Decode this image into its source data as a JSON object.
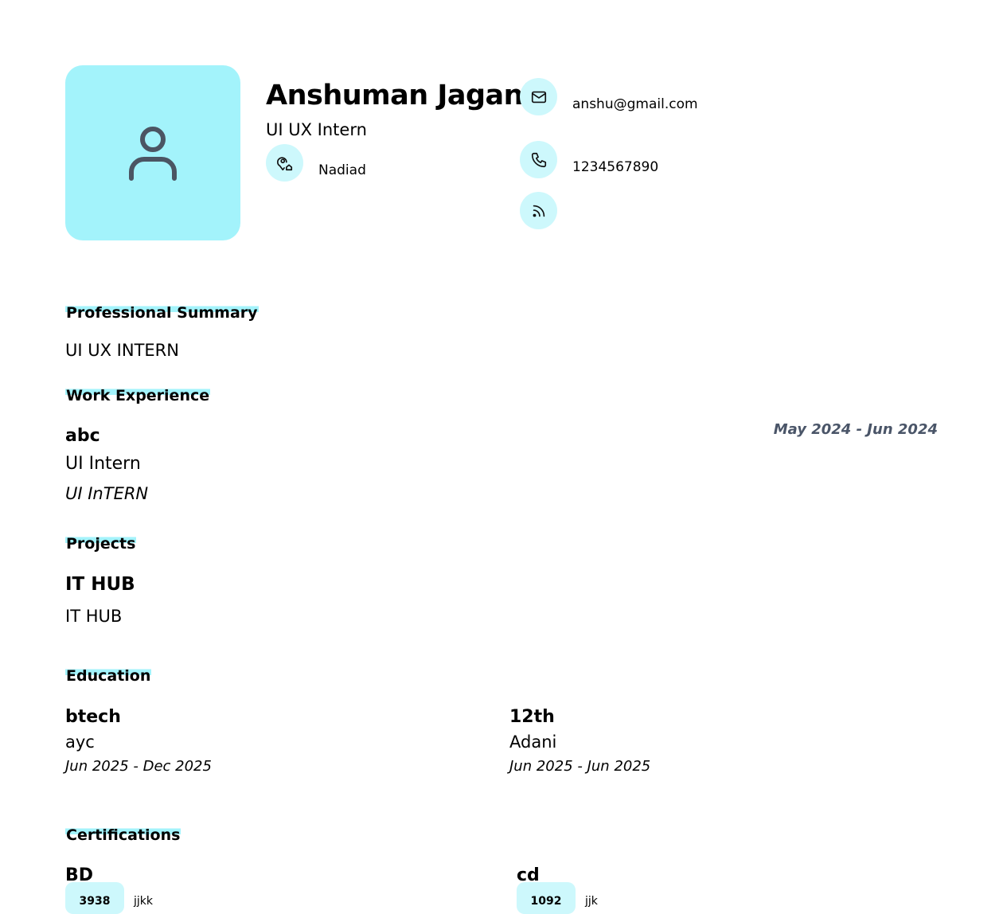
{
  "header": {
    "name": "Anshuman Jagani",
    "role": "UI UX Intern",
    "location": "Nadiad",
    "email": "anshu@gmail.com",
    "phone": "1234567890"
  },
  "icons": {
    "photo": "user-icon",
    "location": "map-pin-home-icon",
    "email": "mail-icon",
    "phone": "phone-icon",
    "rss": "rss-icon"
  },
  "colors": {
    "accent": "#a3f3fb",
    "icon_bg": "#cdf8fc",
    "date_grey": "#4a5568"
  },
  "summary": {
    "title": "Professional Summary",
    "text": "UI UX INTERN"
  },
  "experience": {
    "title": "Work Experience",
    "items": [
      {
        "company": "abc",
        "position": "UI Intern",
        "description": "UI InTERN",
        "dates": "May 2024 - Jun 2024"
      }
    ]
  },
  "projects": {
    "title": "Projects",
    "items": [
      {
        "name": "IT HUB",
        "description": "IT HUB"
      }
    ]
  },
  "education": {
    "title": "Education",
    "items": [
      {
        "degree": "btech",
        "school": "ayc",
        "dates": "Jun 2025 - Dec 2025"
      },
      {
        "degree": "12th",
        "school": "Adani",
        "dates": "Jun 2025 - Jun 2025"
      }
    ]
  },
  "certifications": {
    "title": "Certifications",
    "items": [
      {
        "name": "BD",
        "badge": "3938",
        "issuer": "jjkk"
      },
      {
        "name": "cd",
        "badge": "1092",
        "issuer": "jjk"
      }
    ]
  }
}
